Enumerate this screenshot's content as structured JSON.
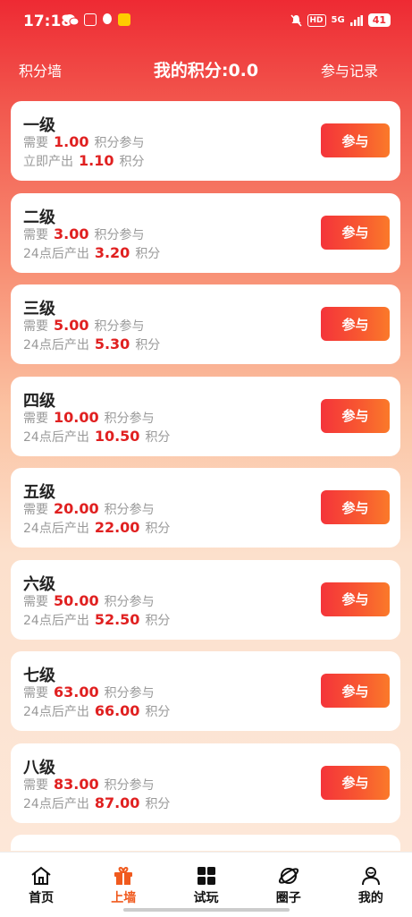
{
  "status_bar": {
    "time": "17:18",
    "network": "5G",
    "hd": "HD",
    "battery": "41"
  },
  "header": {
    "left_link": "积分墙",
    "title": "我的积分:0.0",
    "right_link": "参与记录"
  },
  "labels": {
    "need": "需要",
    "join_suffix": "积分参与",
    "points": "积分"
  },
  "levels": [
    {
      "name": "一级",
      "cost": "1.00",
      "output_prefix": "立即产出",
      "output": "1.10",
      "button": "参与"
    },
    {
      "name": "二级",
      "cost": "3.00",
      "output_prefix": "24点后产出",
      "output": "3.20",
      "button": "参与"
    },
    {
      "name": "三级",
      "cost": "5.00",
      "output_prefix": "24点后产出",
      "output": "5.30",
      "button": "参与"
    },
    {
      "name": "四级",
      "cost": "10.00",
      "output_prefix": "24点后产出",
      "output": "10.50",
      "button": "参与"
    },
    {
      "name": "五级",
      "cost": "20.00",
      "output_prefix": "24点后产出",
      "output": "22.00",
      "button": "参与"
    },
    {
      "name": "六级",
      "cost": "50.00",
      "output_prefix": "24点后产出",
      "output": "52.50",
      "button": "参与"
    },
    {
      "name": "七级",
      "cost": "63.00",
      "output_prefix": "24点后产出",
      "output": "66.00",
      "button": "参与"
    },
    {
      "name": "八级",
      "cost": "83.00",
      "output_prefix": "24点后产出",
      "output": "87.00",
      "button": "参与"
    }
  ],
  "nav": [
    {
      "label": "首页",
      "icon": "home-icon",
      "active": false
    },
    {
      "label": "上墙",
      "icon": "gift-icon",
      "active": true
    },
    {
      "label": "试玩",
      "icon": "grid-icon",
      "active": false
    },
    {
      "label": "圈子",
      "icon": "planet-icon",
      "active": false
    },
    {
      "label": "我的",
      "icon": "user-icon",
      "active": false
    }
  ],
  "colors": {
    "accent": "#ee2a33",
    "value_red": "#e02020",
    "active_nav": "#f05a1e"
  }
}
